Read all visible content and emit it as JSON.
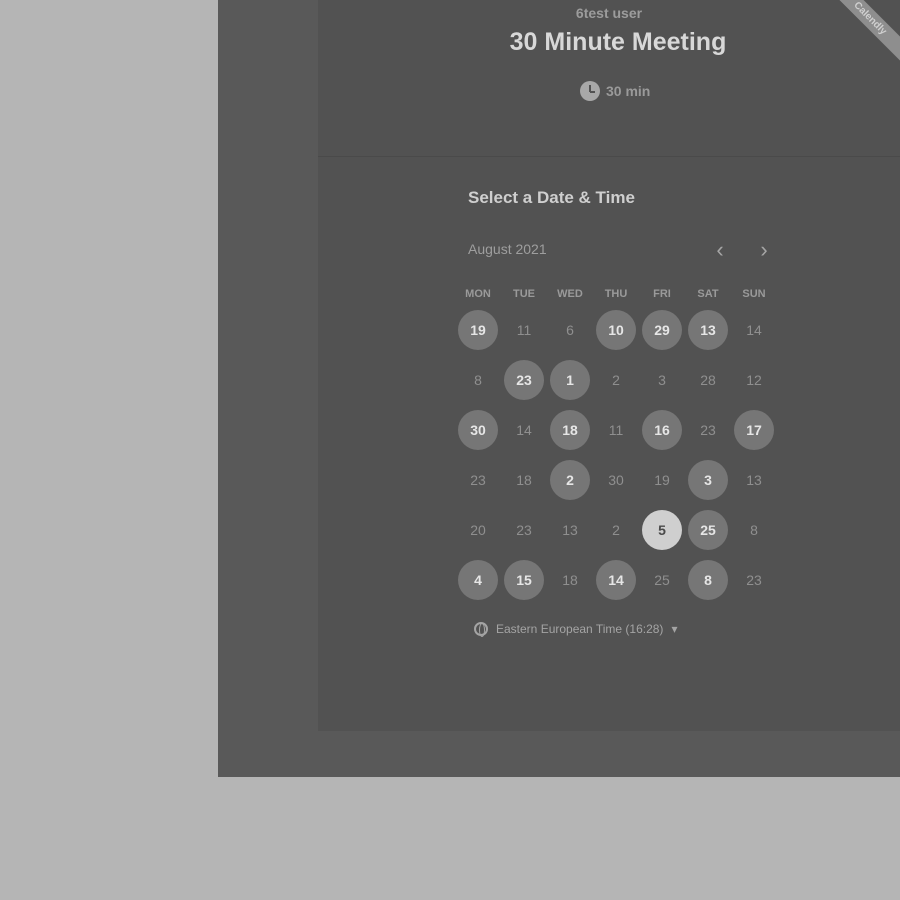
{
  "event": {
    "owner": "6test user",
    "title": "30 Minute Meeting",
    "duration": "30 min",
    "ribbon_text": "Calendly"
  },
  "calendar": {
    "heading": "Select a Date & Time",
    "month_label": "August 2021",
    "prev_icon": "chevron-left-icon",
    "next_icon": "chevron-right-icon",
    "weekdays": [
      "MON",
      "TUE",
      "WED",
      "THU",
      "FRI",
      "SAT",
      "SUN"
    ],
    "weeks": [
      [
        {
          "d": "19",
          "s": "available"
        },
        {
          "d": "11",
          "s": "unavailable"
        },
        {
          "d": "6",
          "s": "unavailable"
        },
        {
          "d": "10",
          "s": "available"
        },
        {
          "d": "29",
          "s": "available"
        },
        {
          "d": "13",
          "s": "available"
        },
        {
          "d": "14",
          "s": "unavailable"
        }
      ],
      [
        {
          "d": "8",
          "s": "unavailable"
        },
        {
          "d": "23",
          "s": "available"
        },
        {
          "d": "1",
          "s": "available"
        },
        {
          "d": "2",
          "s": "unavailable"
        },
        {
          "d": "3",
          "s": "unavailable"
        },
        {
          "d": "28",
          "s": "unavailable"
        },
        {
          "d": "12",
          "s": "unavailable"
        }
      ],
      [
        {
          "d": "30",
          "s": "available"
        },
        {
          "d": "14",
          "s": "unavailable"
        },
        {
          "d": "18",
          "s": "available"
        },
        {
          "d": "11",
          "s": "unavailable"
        },
        {
          "d": "16",
          "s": "available"
        },
        {
          "d": "23",
          "s": "unavailable"
        },
        {
          "d": "17",
          "s": "available"
        }
      ],
      [
        {
          "d": "23",
          "s": "unavailable"
        },
        {
          "d": "18",
          "s": "unavailable"
        },
        {
          "d": "2",
          "s": "available"
        },
        {
          "d": "30",
          "s": "unavailable"
        },
        {
          "d": "19",
          "s": "unavailable"
        },
        {
          "d": "3",
          "s": "available"
        },
        {
          "d": "13",
          "s": "unavailable"
        }
      ],
      [
        {
          "d": "20",
          "s": "unavailable"
        },
        {
          "d": "23",
          "s": "unavailable"
        },
        {
          "d": "13",
          "s": "unavailable"
        },
        {
          "d": "2",
          "s": "unavailable"
        },
        {
          "d": "5",
          "s": "selected"
        },
        {
          "d": "25",
          "s": "available"
        },
        {
          "d": "8",
          "s": "unavailable"
        }
      ],
      [
        {
          "d": "4",
          "s": "available"
        },
        {
          "d": "15",
          "s": "available"
        },
        {
          "d": "18",
          "s": "unavailable"
        },
        {
          "d": "14",
          "s": "available"
        },
        {
          "d": "25",
          "s": "unavailable"
        },
        {
          "d": "8",
          "s": "available"
        },
        {
          "d": "23",
          "s": "unavailable"
        }
      ]
    ],
    "timezone_label": "Eastern European Time (16:28)",
    "timezone_icon": "globe-icon"
  },
  "colors": {
    "background": "#b5b5b5",
    "card": "#525252",
    "available": "#767676",
    "selected": "#cfcfcf"
  }
}
